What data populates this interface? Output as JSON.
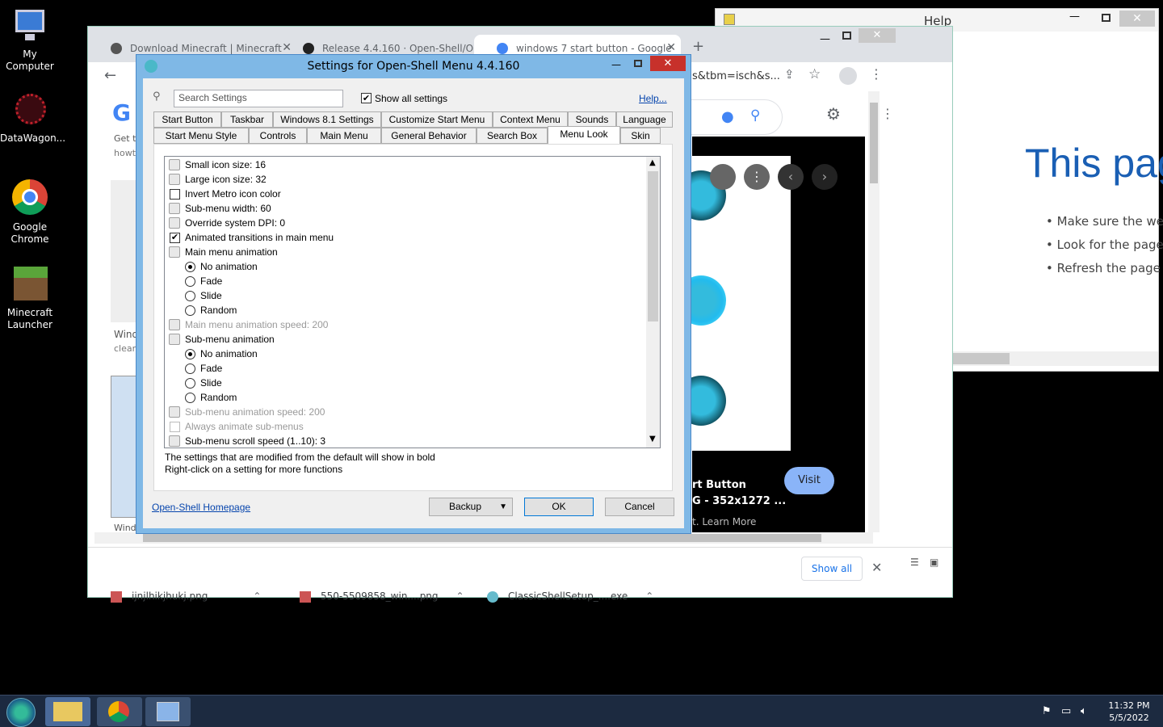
{
  "desktop": {
    "icons": [
      {
        "label_line1": "My",
        "label_line2": "Computer"
      },
      {
        "label_line1": "DataWagon...",
        "label_line2": ""
      },
      {
        "label_line1": "Google",
        "label_line2": "Chrome"
      },
      {
        "label_line1": "Minecraft",
        "label_line2": "Launcher"
      }
    ]
  },
  "chrome": {
    "tabs": [
      {
        "label": "Download Minecraft | Minecraft"
      },
      {
        "label": "Release 4.4.160 · Open-Shell/Op"
      },
      {
        "label": "windows 7 start button - Google"
      }
    ],
    "url_fragment": "s&tbm=isch&s...",
    "page_left_text": [
      "Get t",
      "howt",
      "Wind",
      "clean",
      "Wind"
    ],
    "result_title": "rt Button",
    "result_size": "G - 352x1272 ...",
    "result_learn": "t. Learn More",
    "visit_label": "Visit",
    "downloads": [
      {
        "name": "ijnjlhikjhukj.png"
      },
      {
        "name": "550-5509858_win....png"
      },
      {
        "name": "ClassicShellSetup_....exe"
      }
    ],
    "show_all": "Show all"
  },
  "help": {
    "title": "Help",
    "heading": "This pag",
    "bullets": [
      "Make sure the wel",
      "Look for the page",
      "Refresh the page i"
    ]
  },
  "dialog": {
    "title": "Settings for Open-Shell Menu 4.4.160",
    "search_placeholder": "Search Settings",
    "show_all_label": "Show all settings",
    "help_link": "Help...",
    "tabs_row1": [
      "Start Button",
      "Taskbar",
      "Windows 8.1 Settings",
      "Customize Start Menu",
      "Context Menu",
      "Sounds",
      "Language"
    ],
    "tabs_row2": [
      "Start Menu Style",
      "Controls",
      "Main Menu",
      "General Behavior",
      "Search Box",
      "Menu Look",
      "Skin"
    ],
    "settings": [
      {
        "type": "gear",
        "label": "Small icon size: 16",
        "disabled": false
      },
      {
        "type": "gear",
        "label": "Large icon size: 32",
        "disabled": false
      },
      {
        "type": "check",
        "checked": false,
        "label": "Invert Metro icon color",
        "disabled": false
      },
      {
        "type": "gear",
        "label": "Sub-menu width: 60",
        "disabled": false
      },
      {
        "type": "gear",
        "label": "Override system DPI: 0",
        "disabled": false
      },
      {
        "type": "check",
        "checked": true,
        "label": "Animated transitions in main menu",
        "disabled": false
      },
      {
        "type": "gear",
        "label": "Main menu animation",
        "disabled": false
      },
      {
        "type": "radio",
        "checked": true,
        "label": "No animation",
        "disabled": false
      },
      {
        "type": "radio",
        "checked": false,
        "label": "Fade",
        "disabled": false
      },
      {
        "type": "radio",
        "checked": false,
        "label": "Slide",
        "disabled": false
      },
      {
        "type": "radio",
        "checked": false,
        "label": "Random",
        "disabled": false
      },
      {
        "type": "gear",
        "label": "Main menu animation speed: 200",
        "disabled": true
      },
      {
        "type": "gear",
        "label": "Sub-menu animation",
        "disabled": false
      },
      {
        "type": "radio",
        "checked": true,
        "label": "No animation",
        "disabled": false
      },
      {
        "type": "radio",
        "checked": false,
        "label": "Fade",
        "disabled": false
      },
      {
        "type": "radio",
        "checked": false,
        "label": "Slide",
        "disabled": false
      },
      {
        "type": "radio",
        "checked": false,
        "label": "Random",
        "disabled": false
      },
      {
        "type": "gear",
        "label": "Sub-menu animation speed: 200",
        "disabled": true
      },
      {
        "type": "check",
        "checked": false,
        "label": "Always animate sub-menus",
        "disabled": true
      },
      {
        "type": "gear",
        "label": "Sub-menu scroll speed (1..10): 3",
        "disabled": false
      }
    ],
    "hint1": "The settings that are modified from the default will show in bold",
    "hint2": "Right-click on a setting for more functions",
    "homepage_link": "Open-Shell Homepage",
    "backup_label": "Backup",
    "ok_label": "OK",
    "cancel_label": "Cancel"
  },
  "taskbar": {
    "time": "11:32 PM",
    "date": "5/5/2022"
  }
}
